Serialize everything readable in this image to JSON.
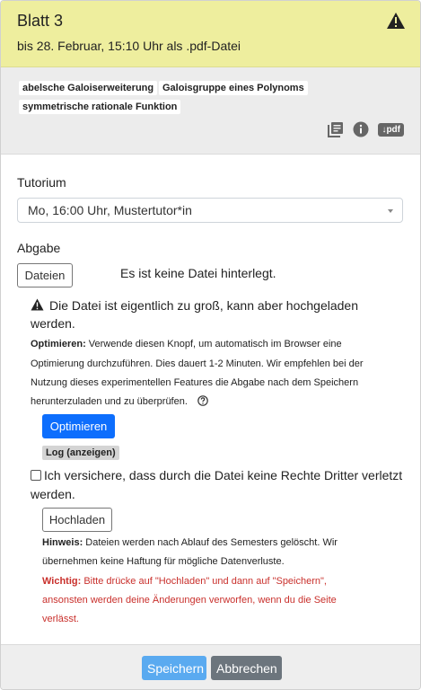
{
  "header": {
    "title": "Blatt 3",
    "deadline": "bis 28. Februar, 15:10 Uhr als .pdf-Datei"
  },
  "tags": [
    "abelsche Galoiserweiterung",
    "Galoisgruppe eines Polynoms",
    "symmetrische rationale Funktion"
  ],
  "tools": {
    "pdf_label": "↓pdf"
  },
  "tutorium": {
    "label": "Tutorium",
    "selected": "Mo, 16:00 Uhr, Mustertutor*in"
  },
  "abgabe": {
    "label": "Abgabe",
    "files_button": "Dateien",
    "no_file": "Es ist keine Datei hinterlegt.",
    "warning_line1": "Die Datei ist eigentlich zu groß, kann aber hochgeladen",
    "warning_line2": "werden.",
    "optimize_bold": "Optimieren:",
    "optimize_line1": "Verwende diesen Knopf, um automatisch im Browser eine",
    "optimize_line2": "Optimierung durchzuführen. Dies dauert 1-2 Minuten. Wir empfehlen bei der",
    "optimize_line3": "Nutzung dieses experimentellen Features die Abgabe nach dem Speichern",
    "optimize_line4": "herunterzuladen und zu überprüfen.",
    "optimize_button": "Optimieren",
    "log_label": "Log (anzeigen)",
    "confirm_line1": "Ich versichere, dass durch die Datei keine Rechte Dritter verletzt",
    "confirm_line2": "werden.",
    "upload_button": "Hochladen",
    "hint_bold": "Hinweis:",
    "hint_line1": "Dateien werden nach Ablauf des Semesters gelöscht. Wir",
    "hint_line2": "übernehmen keine Haftung für mögliche Datenverluste.",
    "important_bold": "Wichtig:",
    "important_line1": "Bitte drücke auf \"Hochladen\" und dann auf \"Speichern\",",
    "important_line2": "ansonsten werden deine Änderungen verworfen, wenn du die Seite",
    "important_line3": "verlässt."
  },
  "footer": {
    "save": "Speichern",
    "cancel": "Abbrechen"
  },
  "colors": {
    "header_bg": "#eeee9e",
    "primary": "#0d6efd",
    "important": "#c9302c"
  }
}
